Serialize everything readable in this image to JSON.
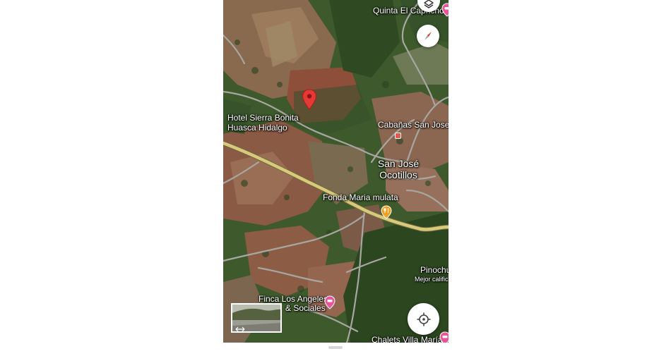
{
  "map": {
    "view": "satellite",
    "accent_colors": {
      "pin": "#e53935",
      "hotel_poi": "#e8559a",
      "food_poi": "#f0a020",
      "road_highway": "#d9c97a",
      "road_local": "#9e9e9e"
    },
    "labels": {
      "quinta": "Quinta El Capricho",
      "hotel_line1": "Hotel Sierra Bonita",
      "hotel_line2": "Huasca Hidalgo",
      "cabanas": "Cabañas San Jose O",
      "town_line1": "San José",
      "town_line2": "Ocotillos",
      "fonda": "Fonda Maria mulata",
      "pinochu": "Pinochu",
      "mejor": "Mejor calific",
      "finca_line1": "Finca Los Angeles",
      "finca_line2": "& Sociales",
      "chalets": "Chalets Villa María"
    },
    "icons": {
      "pin": "map-pin-icon",
      "layers": "layers-icon",
      "compass": "compass-icon",
      "locate": "my-location-icon",
      "hotel": "hotel-icon",
      "restaurant": "fork-knife-icon",
      "streetview": "street-view-arrows-icon"
    }
  }
}
